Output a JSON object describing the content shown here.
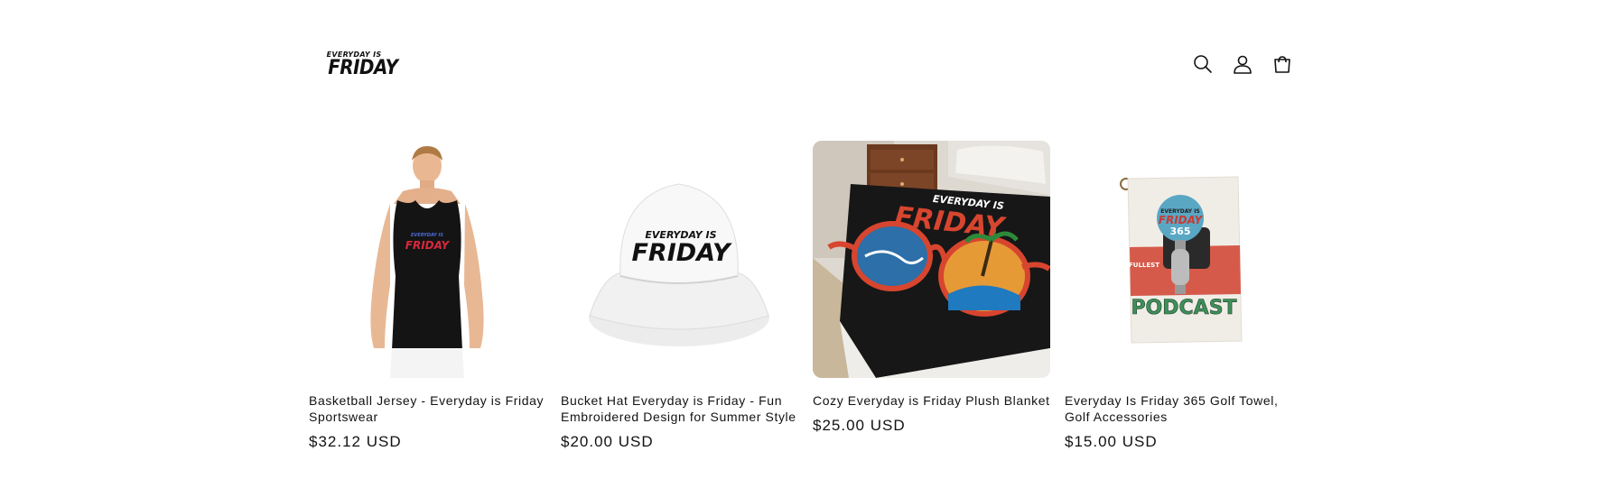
{
  "header": {
    "logo": {
      "line1": "EVERYDAY IS",
      "line2": "FRIDAY"
    },
    "icons": [
      "search-icon",
      "account-icon",
      "cart-icon"
    ]
  },
  "products": [
    {
      "title": "Basketball Jersey - Everyday is Friday Sportswear",
      "price": "$32.12 USD",
      "image_text": [
        "EVERYDAY IS",
        "FRIDAY"
      ]
    },
    {
      "title": "Bucket Hat Everyday is Friday - Fun Embroidered Design for Summer Style",
      "price": "$20.00 USD",
      "image_text": [
        "EVERYDAY IS",
        "FRIDAY"
      ]
    },
    {
      "title": "Cozy Everyday is Friday Plush Blanket",
      "price": "$25.00 USD",
      "image_text": [
        "EVERYDAY IS",
        "FRIDAY"
      ]
    },
    {
      "title": "Everyday Is Friday 365 Golf Towel, Golf Accessories",
      "price": "$15.00 USD",
      "image_text": [
        "EVERYDAY IS",
        "FRIDAY",
        "365",
        "FULLEST",
        "PODCAST"
      ]
    }
  ],
  "colors": {
    "text": "#121212",
    "background": "#ffffff",
    "accent_red": "#d84a3c"
  }
}
